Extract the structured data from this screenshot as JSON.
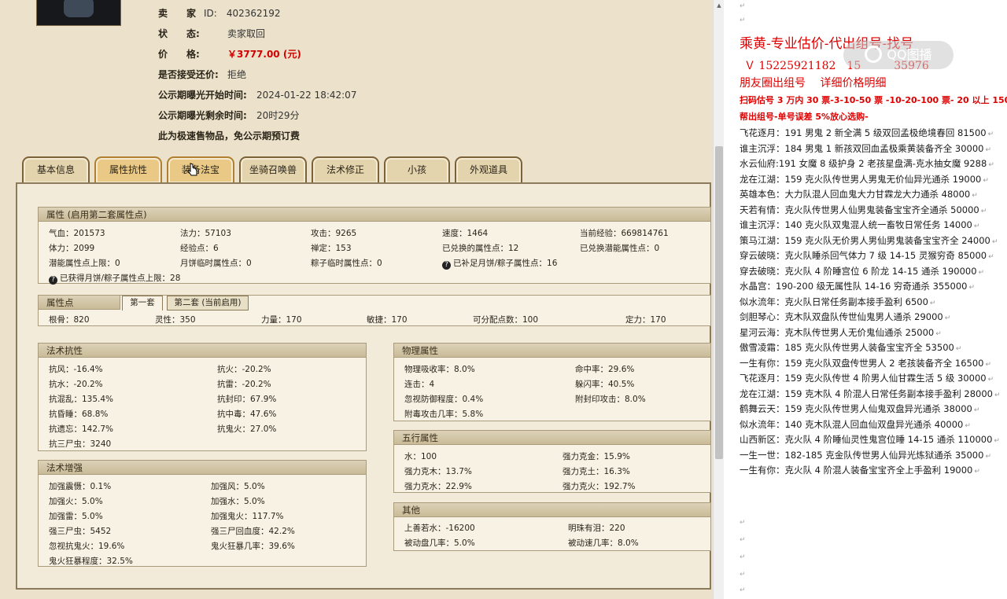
{
  "info": [
    {
      "label": "卖　　家",
      "value": "ID:　402362192"
    },
    {
      "label": "状　　态:",
      "value": "卖家取回"
    },
    {
      "label": "价　　格:",
      "value": "￥3777.00 (元)"
    },
    {
      "label": "是否接受还价:",
      "value": "拒绝"
    },
    {
      "label": "公示期曝光开始时间:",
      "value": "2024-01-22 18:42:07"
    },
    {
      "label": "公示期曝光剩余时间:",
      "value": "20时29分"
    },
    {
      "label": "此为极速售物品，免公示期预订费",
      "value": ""
    }
  ],
  "tabs": [
    "基本信息",
    "属性抗性",
    "装备法宝",
    "坐骑召唤兽",
    "法术修正",
    "小孩",
    "外观道具"
  ],
  "attr_section": {
    "title": "属性 (启用第二套属性点)",
    "rows": [
      [
        "气血：201573",
        "法力：57103",
        "攻击：9265",
        "速度：1464",
        "当前经验：669814761"
      ],
      [
        "体力：2099",
        "经验点：6",
        "禅定：153",
        "已兑换的属性点：12",
        "已兑换潜能属性点：0"
      ],
      [
        "潜能属性点上限：0",
        "月饼临时属性点：0",
        "粽子临时属性点：0",
        "已补足月饼/粽子属性点：16",
        ""
      ]
    ],
    "note": "已获得月饼/粽子属性点上限：28"
  },
  "points_section": {
    "title": "属性点",
    "subtabs": [
      "第一套",
      "第二套 (当前启用)"
    ],
    "row": [
      "根骨：820",
      "灵性：350",
      "力量：170",
      "敏捷：170",
      "可分配点数：100",
      "定力：170"
    ]
  },
  "fashu_kang": {
    "title": "法术抗性",
    "rows": [
      [
        "抗风：-16.4%",
        "抗火：-20.2%"
      ],
      [
        "抗水：-20.2%",
        "抗雷：-20.2%"
      ],
      [
        "抗混乱：135.4%",
        "抗封印：67.9%"
      ],
      [
        "抗昏睡：68.8%",
        "抗中毒：47.6%"
      ],
      [
        "抗遗忘：142.7%",
        "抗鬼火：27.0%"
      ],
      [
        "抗三尸虫：3240",
        ""
      ]
    ]
  },
  "fashu_zeng": {
    "title": "法术增强",
    "rows": [
      [
        "加强震慑：0.1%",
        "加强风：5.0%"
      ],
      [
        "加强火：5.0%",
        "加强水：5.0%"
      ],
      [
        "加强雷：5.0%",
        "加强鬼火：117.7%"
      ],
      [
        "强三尸虫：5452",
        "强三尸回血度：42.2%"
      ],
      [
        "忽视抗鬼火：19.6%",
        "鬼火狂暴几率：39.6%"
      ],
      [
        "鬼火狂暴程度：32.5%",
        ""
      ]
    ]
  },
  "wuli": {
    "title": "物理属性",
    "rows": [
      [
        "物理吸收率：8.0%",
        "命中率：29.6%"
      ],
      [
        "连击：4",
        "躲闪率：40.5%"
      ],
      [
        "忽视防御程度：0.4%",
        "附封印攻击：8.0%"
      ],
      [
        "附毒攻击几率：5.8%",
        ""
      ]
    ]
  },
  "wuxing": {
    "title": "五行属性",
    "rows": [
      [
        "水：100",
        "强力克金：15.9%"
      ],
      [
        "强力克木：13.7%",
        "强力克土：16.3%"
      ],
      [
        "强力克水：22.9%",
        "强力克火：192.7%"
      ]
    ]
  },
  "other": {
    "title": "其他",
    "rows": [
      [
        "上善若水：-16200",
        "明珠有泪：220"
      ],
      [
        "被动盘几率：5.0%",
        "被动速几率：8.0%"
      ]
    ]
  },
  "doc": {
    "title": "乘黄-专业估价-代出组号-找号",
    "contact": "Ｖ 15225921182　15",
    "contact2": "35976",
    "line3": "朋友圈出组号　 详细价格明细",
    "line4": "扫码估号 3 万内 30 票-3-10-50 票 -10-20-100 票- 20 以上 150",
    "line5": "帮出组号-单号误差 5%放心选购-",
    "entries": [
      "飞花逐月：191 男鬼 2 新全满 5 级双回孟极绝境春回 81500",
      "谁主沉浮：184 男鬼 1 新孩双回血孟极乘黄装备齐全 30000",
      "水云仙府:191 女魔 8 级护身 2 老孩星盘满-克水抽女魔 9288",
      "龙在江湖：159 克火队传世男人男鬼无价仙异光通杀 19000",
      "英雄本色：大力队混人回血鬼大力甘霖龙大力通杀 48000",
      "天若有情：克火队传世男人仙男鬼装备宝宝齐全通杀 50000",
      "谁主沉浮：140 克火队双鬼混人统一畜牧日常任务 14000",
      "策马江湖：159 克火队无价男人男仙男鬼装备宝宝齐全 24000",
      "穿云破晓：克火队睡杀回气体力 7 级 14-15 灵猴穷奇 85000",
      "穿去破晓：克火队 4 阶睡宫位 6 阶龙 14-15 通杀 190000",
      "水晶宫：190-200 级无属性队 14-16 穷奇通杀 355000",
      "似水流年：克火队日常任务副本接手盈利 6500",
      "剑胆琴心：克木队双盘队传世仙鬼男人通杀 29000",
      "星河云海：克木队传世男人无价鬼仙通杀 25000",
      "傲雪凌霜：185 克火队传世男人装备宝宝齐全 53500",
      "一生有你：159 克火队双盘传世男人 2 老孩装备齐全 16500",
      "飞花逐月：159 克火队传世 4 阶男人仙甘霖生活 5 级 30000",
      "龙在江湖：159 克木队 4 阶混人日常任务副本接手盈利 28000",
      "鹤舞云天：159 克火队传世男人仙鬼双盘异光通杀 38000",
      "似水流年：140 克木队混人回血仙双盘异光通杀 40000",
      "山西新区：克火队 4 阶睡仙灵性鬼宫位睡 14-15 通杀 110000",
      "一生一世：182-185 克金队传世男人仙异光炼狱通杀 35000",
      "一生有你：克火队 4 阶混人装备宝宝齐全上手盈利 19000"
    ]
  }
}
